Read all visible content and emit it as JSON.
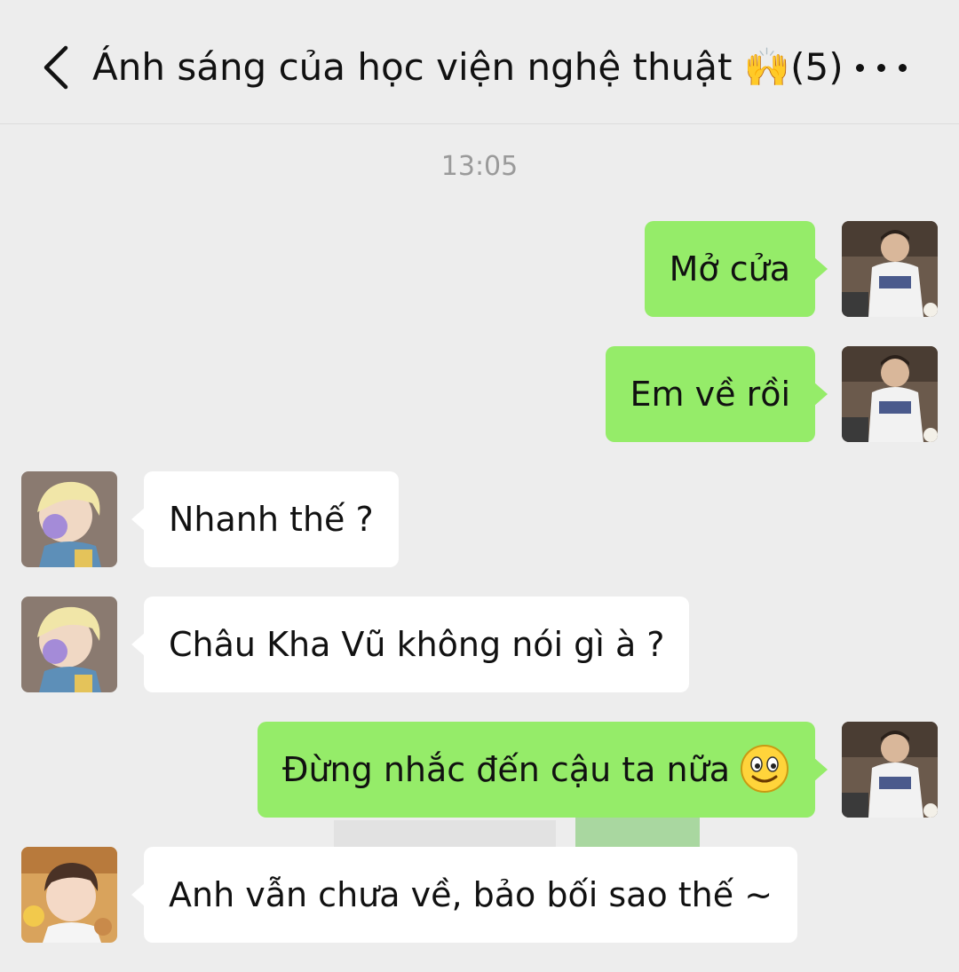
{
  "header": {
    "title": "Ánh sáng của học viện nghệ thuật 🙌(5)"
  },
  "timestamp": "13:05",
  "messages": [
    {
      "sender": "me",
      "text": "Mở cửa"
    },
    {
      "sender": "me",
      "text": "Em về rồi"
    },
    {
      "sender": "other",
      "text": "Nhanh thế ?"
    },
    {
      "sender": "other",
      "text": "Châu Kha Vũ không nói gì à ?"
    },
    {
      "sender": "me",
      "text": "Đừng nhắc đến cậu ta nữa",
      "emoji": "smile-icon"
    },
    {
      "sender": "other2",
      "text": "Anh vẫn chưa về, bảo bối sao thế ~"
    }
  ],
  "colors": {
    "background": "#ededed",
    "my_bubble": "#95ec69",
    "their_bubble": "#ffffff"
  }
}
